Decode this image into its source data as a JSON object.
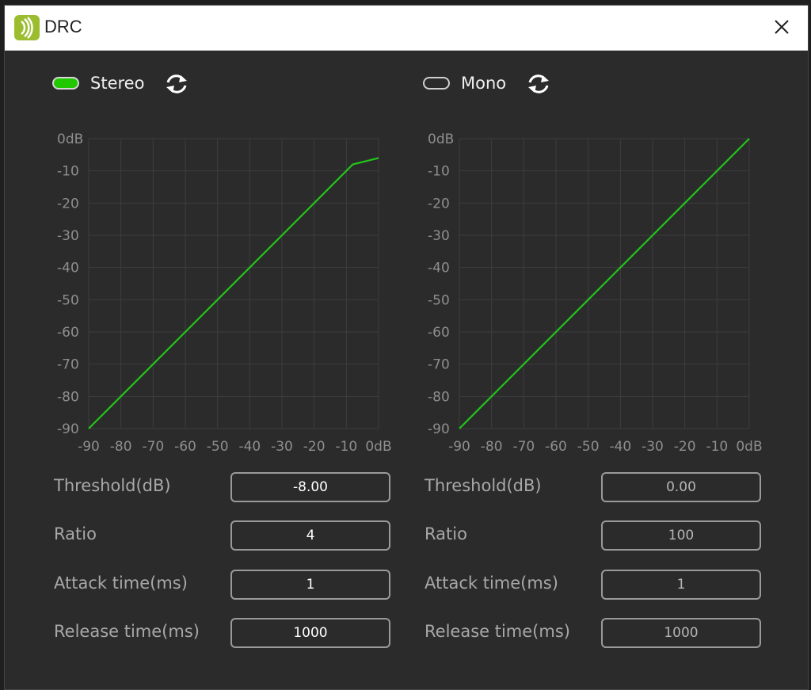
{
  "window": {
    "title": "DRC"
  },
  "panels": {
    "left": {
      "mode_label": "Stereo",
      "toggle_on": true,
      "params": [
        {
          "label": "Threshold(dB)",
          "value": "-8.00"
        },
        {
          "label": "Ratio",
          "value": "4"
        },
        {
          "label": "Attack time(ms)",
          "value": "1"
        },
        {
          "label": "Release time(ms)",
          "value": "1000"
        }
      ]
    },
    "right": {
      "mode_label": "Mono",
      "toggle_on": false,
      "params": [
        {
          "label": "Threshold(dB)",
          "value": "0.00"
        },
        {
          "label": "Ratio",
          "value": "100"
        },
        {
          "label": "Attack time(ms)",
          "value": "1"
        },
        {
          "label": "Release time(ms)",
          "value": "1000"
        }
      ]
    }
  },
  "chart_data": [
    {
      "type": "line",
      "title": "",
      "x_ticks": [
        "-90",
        "-80",
        "-70",
        "-60",
        "-50",
        "-40",
        "-30",
        "-20",
        "-10",
        "0dB"
      ],
      "y_ticks": [
        "0dB",
        "-10",
        "-20",
        "-30",
        "-40",
        "-50",
        "-60",
        "-70",
        "-80",
        "-90"
      ],
      "xlim": [
        -90,
        0
      ],
      "ylim": [
        -90,
        0
      ],
      "grid": true,
      "line_color": "#22c51a",
      "series": [
        {
          "x": [
            -90,
            -8,
            0
          ],
          "y": [
            -90,
            -8,
            -6
          ]
        }
      ]
    },
    {
      "type": "line",
      "title": "",
      "x_ticks": [
        "-90",
        "-80",
        "-70",
        "-60",
        "-50",
        "-40",
        "-30",
        "-20",
        "-10",
        "0dB"
      ],
      "y_ticks": [
        "0dB",
        "-10",
        "-20",
        "-30",
        "-40",
        "-50",
        "-60",
        "-70",
        "-80",
        "-90"
      ],
      "xlim": [
        -90,
        0
      ],
      "ylim": [
        -90,
        0
      ],
      "grid": true,
      "line_color": "#22c51a",
      "series": [
        {
          "x": [
            -90,
            0
          ],
          "y": [
            -90,
            0
          ]
        }
      ]
    }
  ],
  "colors": {
    "accent": "#21c800",
    "background": "#2b2b2b",
    "grid": "#3d3d3d"
  }
}
